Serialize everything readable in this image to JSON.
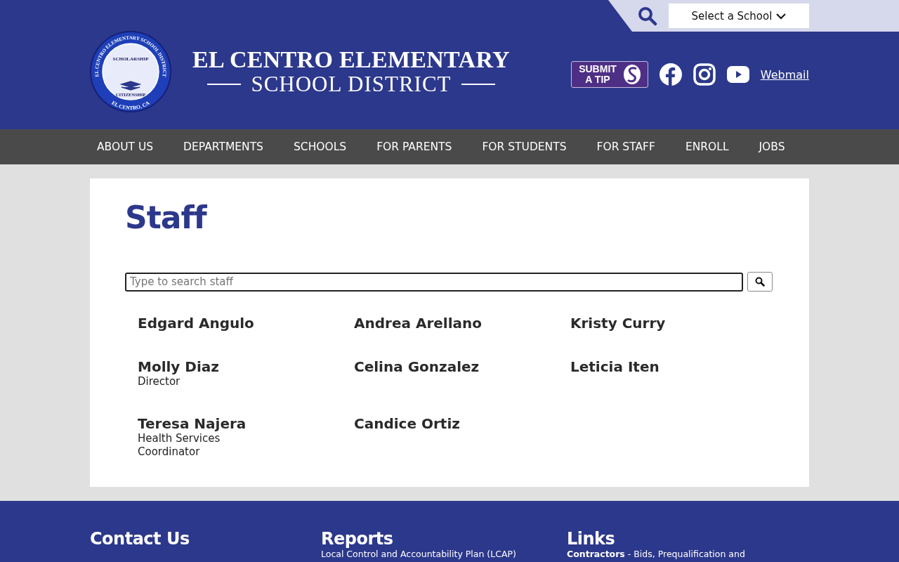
{
  "top_bar": {
    "school_select": "Select a School"
  },
  "logo": {
    "ring_text": "EL CENTRO ELEMENTARY SCHOOL DISTRICT",
    "top_word": "SCHOLARSHIP",
    "bottom_word": "CITIZENSHIP",
    "city": "EL CENTRO, CA",
    "title_line_1": "EL CENTRO ELEMENTARY",
    "title_line_2": "SCHOOL DISTRICT"
  },
  "header_links": {
    "tip_button": [
      "SUBMIT",
      "A TIP"
    ],
    "social": [
      {
        "kind": "facebook"
      },
      {
        "kind": "instagram"
      },
      {
        "kind": "youtube"
      }
    ],
    "webmail": "Webmail"
  },
  "nav": [
    "ABOUT US",
    "DEPARTMENTS",
    "SCHOOLS",
    "FOR PARENTS",
    "FOR STUDENTS",
    "FOR STAFF",
    "ENROLL",
    "JOBS"
  ],
  "page_title": "Staff",
  "search": {
    "placeholder": "Type to search staff"
  },
  "staff": [
    {
      "name": "Edgard Angulo"
    },
    {
      "name": "Andrea Arellano"
    },
    {
      "name": "Kristy Curry"
    },
    {
      "name": "Molly Diaz",
      "role": "Director"
    },
    {
      "name": "Celina Gonzalez"
    },
    {
      "name": "Leticia Iten"
    },
    {
      "name": "Teresa Najera",
      "role": "Health Services Coordinator"
    },
    {
      "name": "Candice Ortiz"
    }
  ],
  "footer": [
    {
      "heading": "Contact Us"
    },
    {
      "heading": "Reports",
      "text": "Local Control and Accountability Plan (LCAP)"
    },
    {
      "heading": "Links",
      "text": "**Contractors** - Bids, Prequalification and"
    }
  ]
}
